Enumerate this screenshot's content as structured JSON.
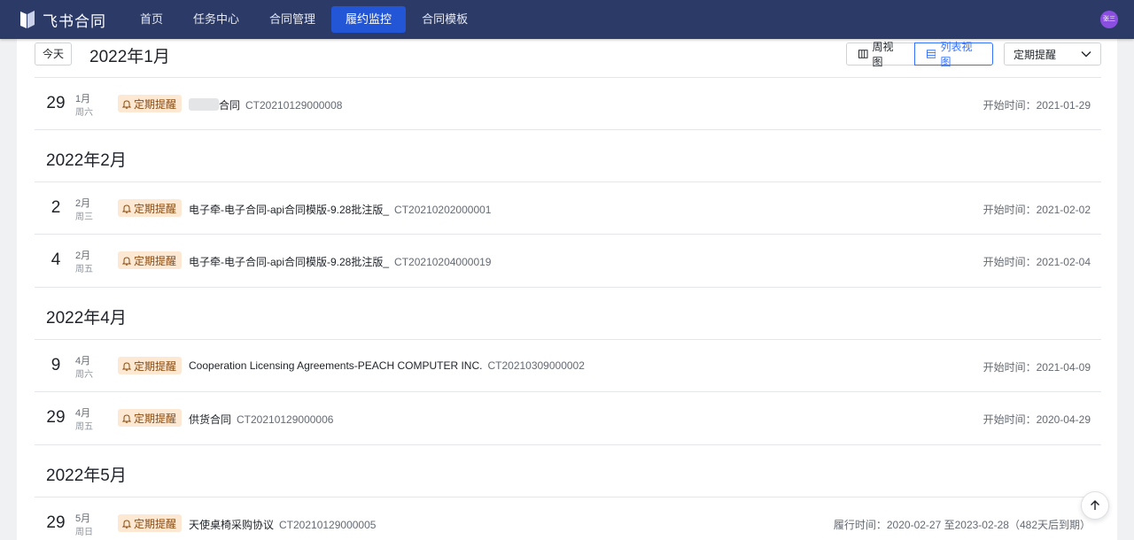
{
  "app": {
    "name": "飞书合同"
  },
  "nav": {
    "items": [
      {
        "label": "首页",
        "active": false
      },
      {
        "label": "任务中心",
        "active": false
      },
      {
        "label": "合同管理",
        "active": false
      },
      {
        "label": "履约监控",
        "active": true
      },
      {
        "label": "合同模板",
        "active": false
      }
    ]
  },
  "user": {
    "avatar_text": "张三"
  },
  "toolbar": {
    "today_label": "今天",
    "current_month": "2022年1月",
    "week_view_label": "周视图",
    "list_view_label": "列表视图",
    "filter_selected": "定期提醒"
  },
  "list": {
    "tag_label": "定期提醒",
    "month_headers": [
      "2022年2月",
      "2022年4月",
      "2022年5月"
    ],
    "rows": [
      {
        "day": "29",
        "month": "1月",
        "weekday": "周六",
        "title": "合同",
        "code": "CT20210129000008",
        "right_text": "开始时间：2021-01-29"
      },
      {
        "day": "2",
        "month": "2月",
        "weekday": "周三",
        "title": "电子牵-电子合同-api合同模版-9.28批注版_",
        "code": "CT20210202000001",
        "right_text": "开始时间：2021-02-02"
      },
      {
        "day": "4",
        "month": "2月",
        "weekday": "周五",
        "title": "电子牵-电子合同-api合同模版-9.28批注版_",
        "code": "CT20210204000019",
        "right_text": "开始时间：2021-02-04"
      },
      {
        "day": "9",
        "month": "4月",
        "weekday": "周六",
        "title": "Cooperation Licensing Agreements-PEACH COMPUTER INC.",
        "code": "CT20210309000002",
        "right_text": "开始时间：2021-04-09"
      },
      {
        "day": "29",
        "month": "4月",
        "weekday": "周五",
        "title": "供货合同",
        "code": "CT20210129000006",
        "right_text": "开始时间：2020-04-29"
      },
      {
        "day": "29",
        "month": "5月",
        "weekday": "周日",
        "title": "天使桌椅采购协议",
        "code": "CT20210129000005",
        "right_text": "履行时间：2020-02-27 至2023-02-28（482天后到期）"
      }
    ]
  },
  "colors": {
    "nav_bg": "#2b3a67",
    "nav_active": "#2356d6",
    "accent": "#3370ff",
    "tag_bg": "#fde8d3"
  }
}
